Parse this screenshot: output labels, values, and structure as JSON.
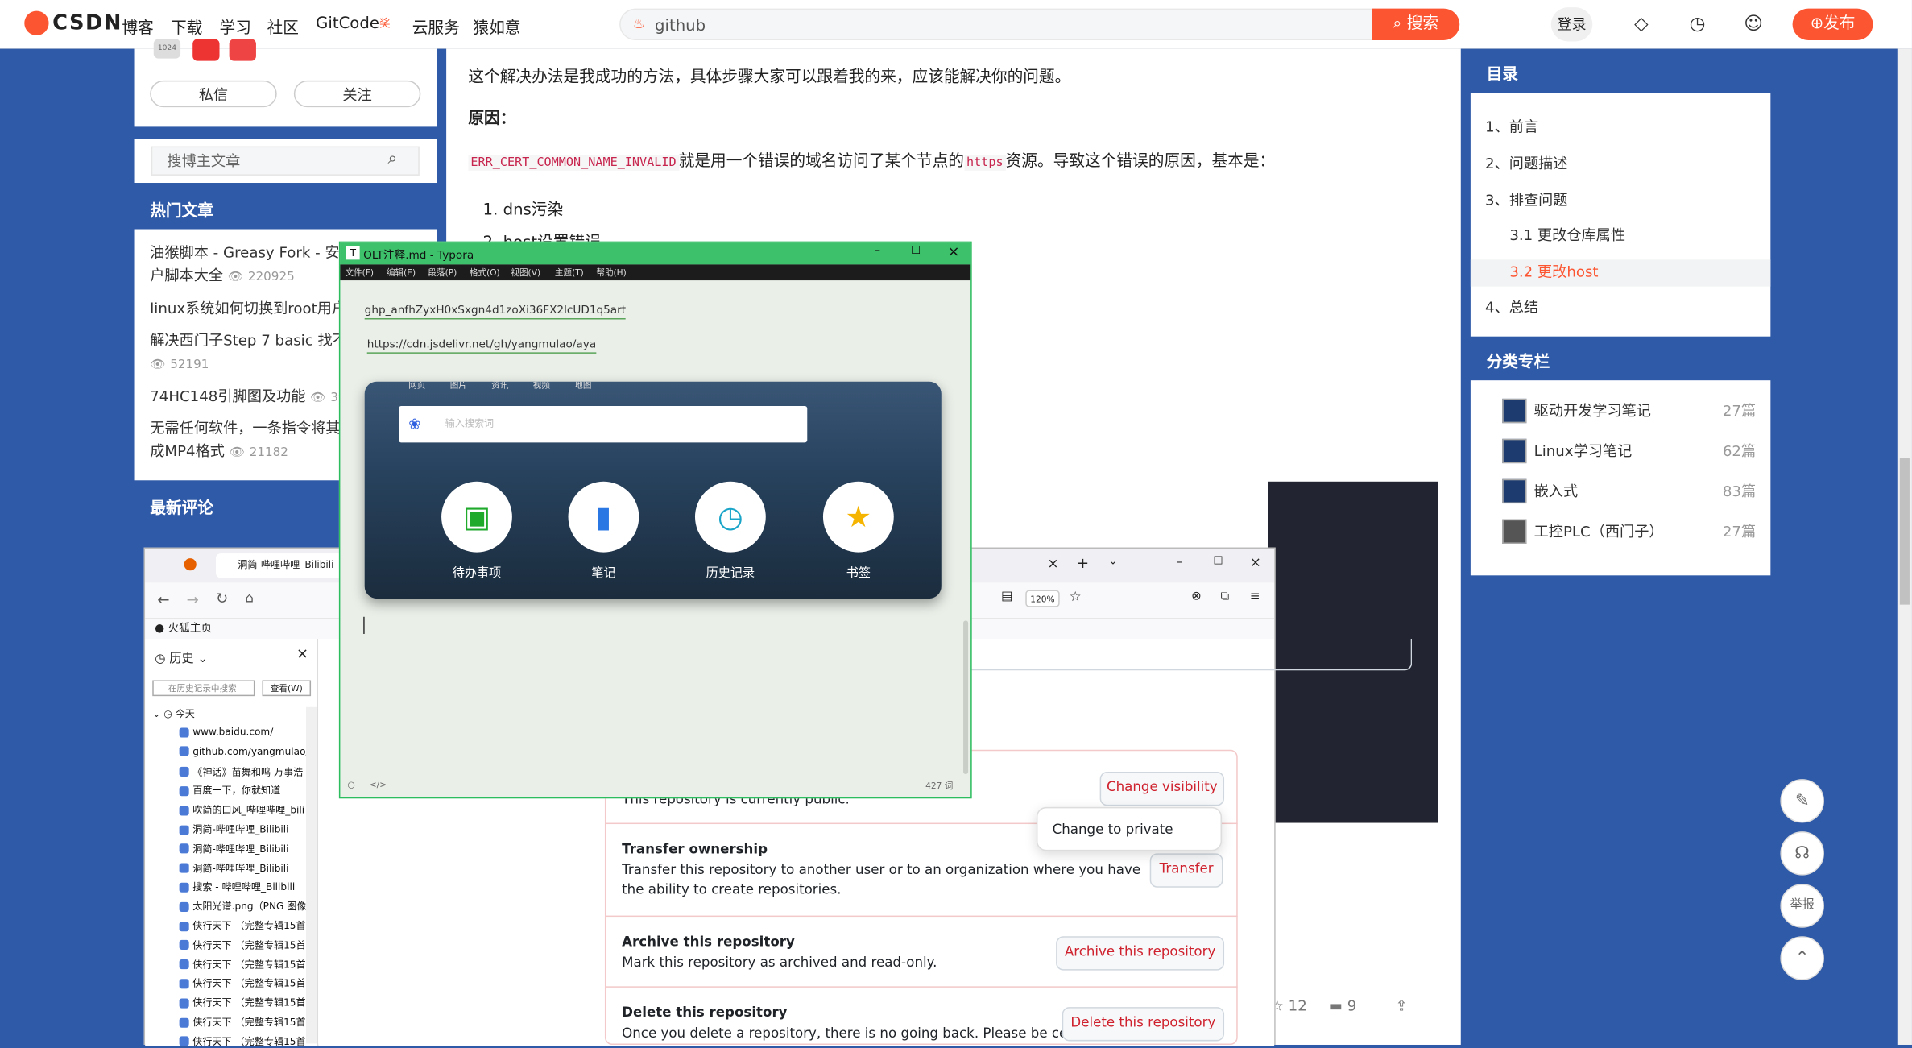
{
  "header": {
    "logo": "CSDN",
    "nav": [
      "博客",
      "下载",
      "学习",
      "社区",
      "GitCode",
      "云服务",
      "猿如意"
    ],
    "gitcode_badge": "奖",
    "search_value": "github",
    "search_button": "搜索",
    "login": "登录",
    "publish": "发布"
  },
  "profile": {
    "message": "私信",
    "follow": "关注",
    "level_badge": "1024"
  },
  "blog_search": {
    "placeholder": "搜博主文章"
  },
  "hot": {
    "title": "热门文章",
    "items": [
      {
        "text": "油猴脚本 - Greasy Fork - 安全",
        "text2": "户脚本大全",
        "views": "220925"
      },
      {
        "text": "linux系统如何切换到root用户",
        "text2": "",
        "views": ""
      },
      {
        "text": "解决西门子Step 7 basic 找不到",
        "text2": "",
        "views": "52191"
      },
      {
        "text": "74HC148引脚图及功能",
        "text2": "",
        "views": "39"
      },
      {
        "text": "无需任何软件，一条指令将其",
        "text2": "成MP4格式",
        "views": "21182"
      }
    ]
  },
  "comments": {
    "title": "最新评论"
  },
  "article": {
    "intro": "这个解决办法是我成功的方法，具体步骤大家可以跟着我的来，应该能解决你的问题。",
    "reason_heading": "原因：",
    "error_code": "ERR_CERT_COMMON_NAME_INVALID",
    "reason_text_a": "就是用一个错误的域名访问了某个节点的",
    "https_code": "https",
    "reason_text_b": "资源。导致这个错误的原因，基本是：",
    "list": [
      "1. dns污染",
      "2. host设置错误"
    ],
    "likes": "12",
    "comments": "9"
  },
  "toc": {
    "title": "目录",
    "items": [
      "1、前言",
      "2、问题描述",
      "3、排查问题",
      "3.1 更改仓库属性",
      "3.2 更改host",
      "4、总结"
    ]
  },
  "columns": {
    "title": "分类专栏",
    "items": [
      {
        "name": "驱动开发学习笔记",
        "count": "27篇"
      },
      {
        "name": "Linux学习笔记",
        "count": "62篇"
      },
      {
        "name": "嵌入式",
        "count": "83篇"
      },
      {
        "name": "工控PLC（西门子）",
        "count": "27篇"
      }
    ]
  },
  "side_tools": {
    "report": "举报"
  },
  "firefox": {
    "tab_title": "洞简-哔哩哔哩_Bilibili",
    "zoom": "120%",
    "bookmark": "火狐主页",
    "history_title": "历史",
    "history_search_placeholder": "在历史记录中搜索",
    "history_view": "查看(W)",
    "history_today": "今天",
    "history_items": [
      "www.baidu.com/",
      "github.com/yangmulao/",
      "《神话》苗舞和鸣 万事浩",
      "百度一下，你就知道",
      "吹简的口风_哔哩哔哩_bili",
      "洞简-哔哩哔哩_Bilibili",
      "洞简-哔哩哔哩_Bilibili",
      "洞简-哔哩哔哩_Bilibili",
      "搜索 - 哔哩哔哩_Bilibili",
      "太阳光谱.png（PNG 图像",
      "侠行天下 （完整专辑15首",
      "侠行天下 （完整专辑15首",
      "侠行天下 （完整专辑15首",
      "侠行天下 （完整专辑15首",
      "侠行天下 （完整专辑15首",
      "侠行天下 （完整专辑15首",
      "侠行天下 （完整专辑15首"
    ]
  },
  "github": {
    "visibility_desc": "This repository is currently public.",
    "change_visibility": "Change visibility",
    "change_to_private": "Change to private",
    "transfer_title": "Transfer ownership",
    "transfer_desc": "Transfer this repository to another user or to an organization where you have the ability to create repositories.",
    "transfer_btn": "Transfer",
    "archive_title": "Archive this repository",
    "archive_desc": "Mark this repository as archived and read-only.",
    "archive_btn": "Archive this repository",
    "delete_title": "Delete this repository",
    "delete_desc": "Once you delete a repository, there is no going back. Please be certain.",
    "delete_btn": "Delete this repository"
  },
  "typora": {
    "title": "OLT注释.md - Typora",
    "menu": [
      "文件(F)",
      "编辑(E)",
      "段落(P)",
      "格式(O)",
      "视图(V)",
      "主题(T)",
      "帮助(H)"
    ],
    "token": "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",
    "cdn_link": "https://cdn.jsdelivr.net/gh/yangmulao/aya",
    "image_tabs": [
      "网页",
      "图片",
      "资讯",
      "视频",
      "地图"
    ],
    "image_search_placeholder": "输入搜索词",
    "image_icons": [
      "待办事项",
      "笔记",
      "历史记录",
      "书签"
    ],
    "word_count": "427 词"
  }
}
